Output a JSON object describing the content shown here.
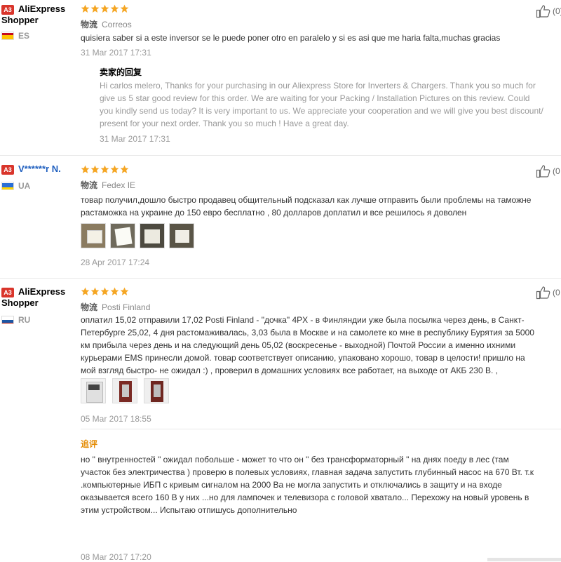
{
  "reviews": [
    {
      "badge": "A3",
      "user_line1": "AliExpress",
      "user_line2": "Shopper",
      "country": "ES",
      "logistics_label": "物流",
      "logistics_value": "Correos",
      "text_lines": [
        "quisiera saber si a este inversor se le puede poner otro en paralelo y si es asi que me haria falta,muchas gracias"
      ],
      "date": "31 Mar 2017 17:31",
      "like": "(0)",
      "reply_title": "卖家的回复",
      "reply_lines": [
        "Hi carlos melero, Thanks for your purchasing in our Aliexpress Store for Inverters & Chargers. Thank you so much for",
        "give us 5 star good review for this order. We are waiting for your Packing / Installation Pictures on this review. Could",
        "you kindly send us today? It is very important to us. We appreciate your cooperation and we will give you best discount/",
        "present for your next order. Thank you so much ! Have a great day."
      ],
      "reply_date": "31 Mar 2017 17:31"
    },
    {
      "badge": "A3",
      "user_line1": "V******r N.",
      "country": "UA",
      "logistics_label": "物流",
      "logistics_value": "Fedex IE",
      "text_lines": [
        "товар получил,дошло быстро продавец общительный подсказал как лучше отправить были проблемы на таможне",
        "растаможка на украине до 150 евро бесплатно , 80 долларов доплатил и все решилось я доволен"
      ],
      "date": "28 Apr 2017 17:24",
      "like": "(0"
    },
    {
      "badge": "A3",
      "user_line1": "AliExpress",
      "user_line2": "Shopper",
      "country": "RU",
      "logistics_label": "物流",
      "logistics_value": "Posti Finland",
      "text_lines": [
        "оплатил 15,02 отправили 17,02 Posti Finland - \"дочка\" 4PX - в Финляндии уже была посылка через день, в Санкт-",
        "Петербурге 25,02, 4 дня растомаживалась, 3,03 была в Москве и на самолете ко мне в республику Бурятия за 5000",
        "км прибыла через день и на следующий день 05,02 (воскресенье - выходной) Почтой России а именно ихними",
        "курьерами EMS принесли домой. товар соответствует описанию, упаковано хорошо, товар в целости! пришло на",
        "мой взгляд быстро- не ожидал :) , проверил в домашних условиях все работает, на выходе от АКБ 230 В. ,"
      ],
      "date": "05 Mar 2017 18:55",
      "like": "(0",
      "followup_title": "追评",
      "followup_lines": [
        "но \" внутренностей \" ожидал побольше - может то что он \" без трансформаторный \" на днях поеду в лес (там",
        "участок без электричества ) проверю в полевых условиях, главная задача запустить глубинный насос на 670 Вт. т.к",
        ".компьютерные ИБП с кривым сигналом на 2000 Ва не могла запустить и отключались в защиту и на входе",
        "оказывается всего 160 В у них ...но для лампочек и телевизора с головой хватало... Перехожу на новый уровень в",
        "этим устройством... Испытаю отпишусь дополнительно"
      ],
      "followup_date": "08 Mar 2017 17:20"
    }
  ],
  "colors": {
    "badge": "#d9352b",
    "star": "#f5a623",
    "followup": "#e48a00"
  },
  "icons": [
    "star-icon",
    "thumbs-up-icon",
    "flag-es-icon",
    "flag-ua-icon",
    "flag-ru-icon"
  ]
}
